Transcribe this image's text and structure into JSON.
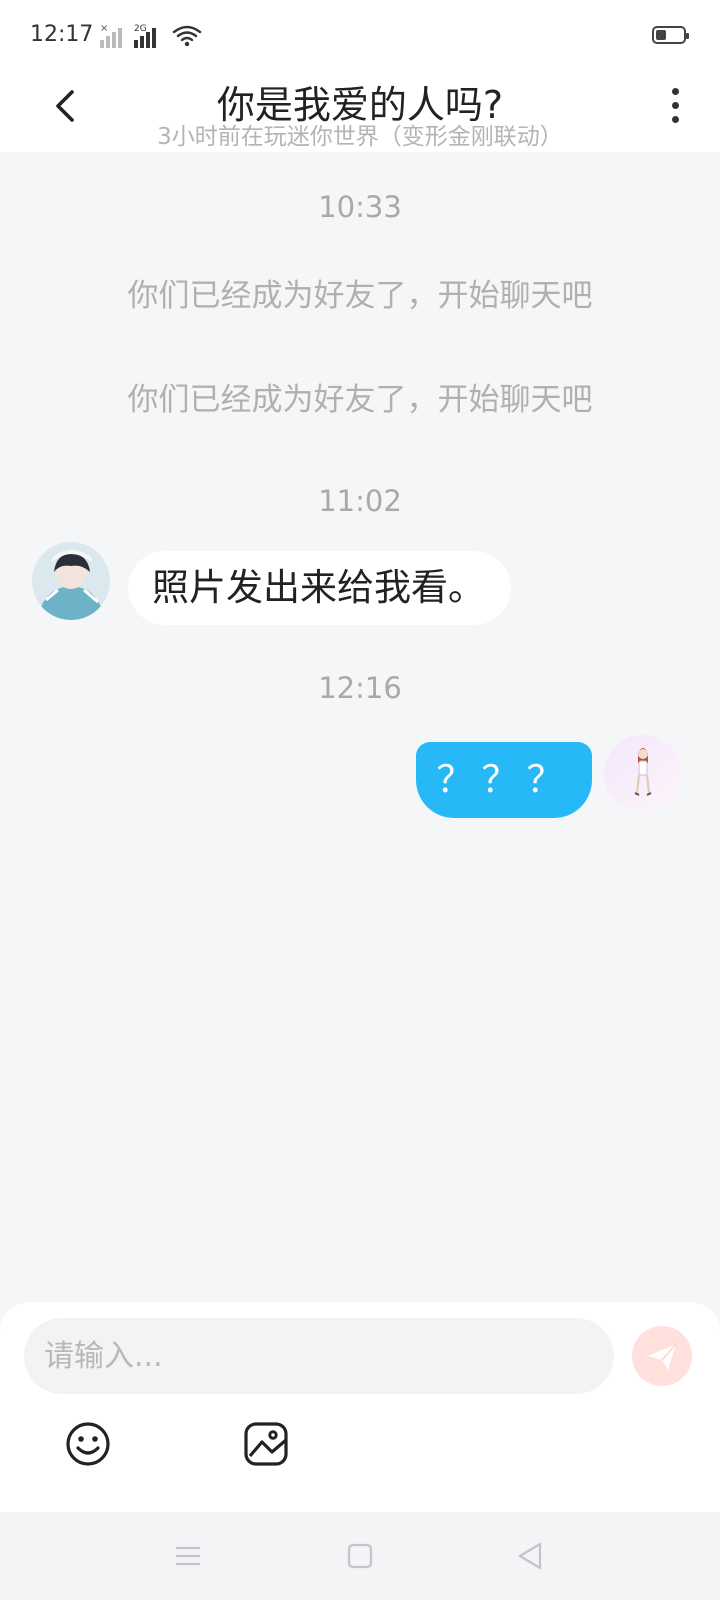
{
  "status_bar": {
    "time": "12:17",
    "signal_label": "2G",
    "icons": [
      "no-signal-icon",
      "signal-icon",
      "wifi-icon",
      "battery-icon"
    ]
  },
  "header": {
    "title": "你是我爱的人吗?",
    "subtitle": "3小时前在玩迷你世界（变形金刚联动）"
  },
  "messages": [
    {
      "type": "timestamp",
      "text": "10:33"
    },
    {
      "type": "system",
      "text": "你们已经成为好友了，开始聊天吧"
    },
    {
      "type": "system",
      "text": "你们已经成为好友了，开始聊天吧"
    },
    {
      "type": "timestamp",
      "text": "11:02"
    },
    {
      "type": "incoming",
      "text": "照片发出来给我看。"
    },
    {
      "type": "timestamp",
      "text": "12:16"
    },
    {
      "type": "outgoing",
      "text": "？？？"
    }
  ],
  "composer": {
    "placeholder": "请输入..."
  },
  "colors": {
    "accent": "#26b8f7",
    "send_button": "#ffe0dc",
    "background": "#f5f6f8"
  }
}
